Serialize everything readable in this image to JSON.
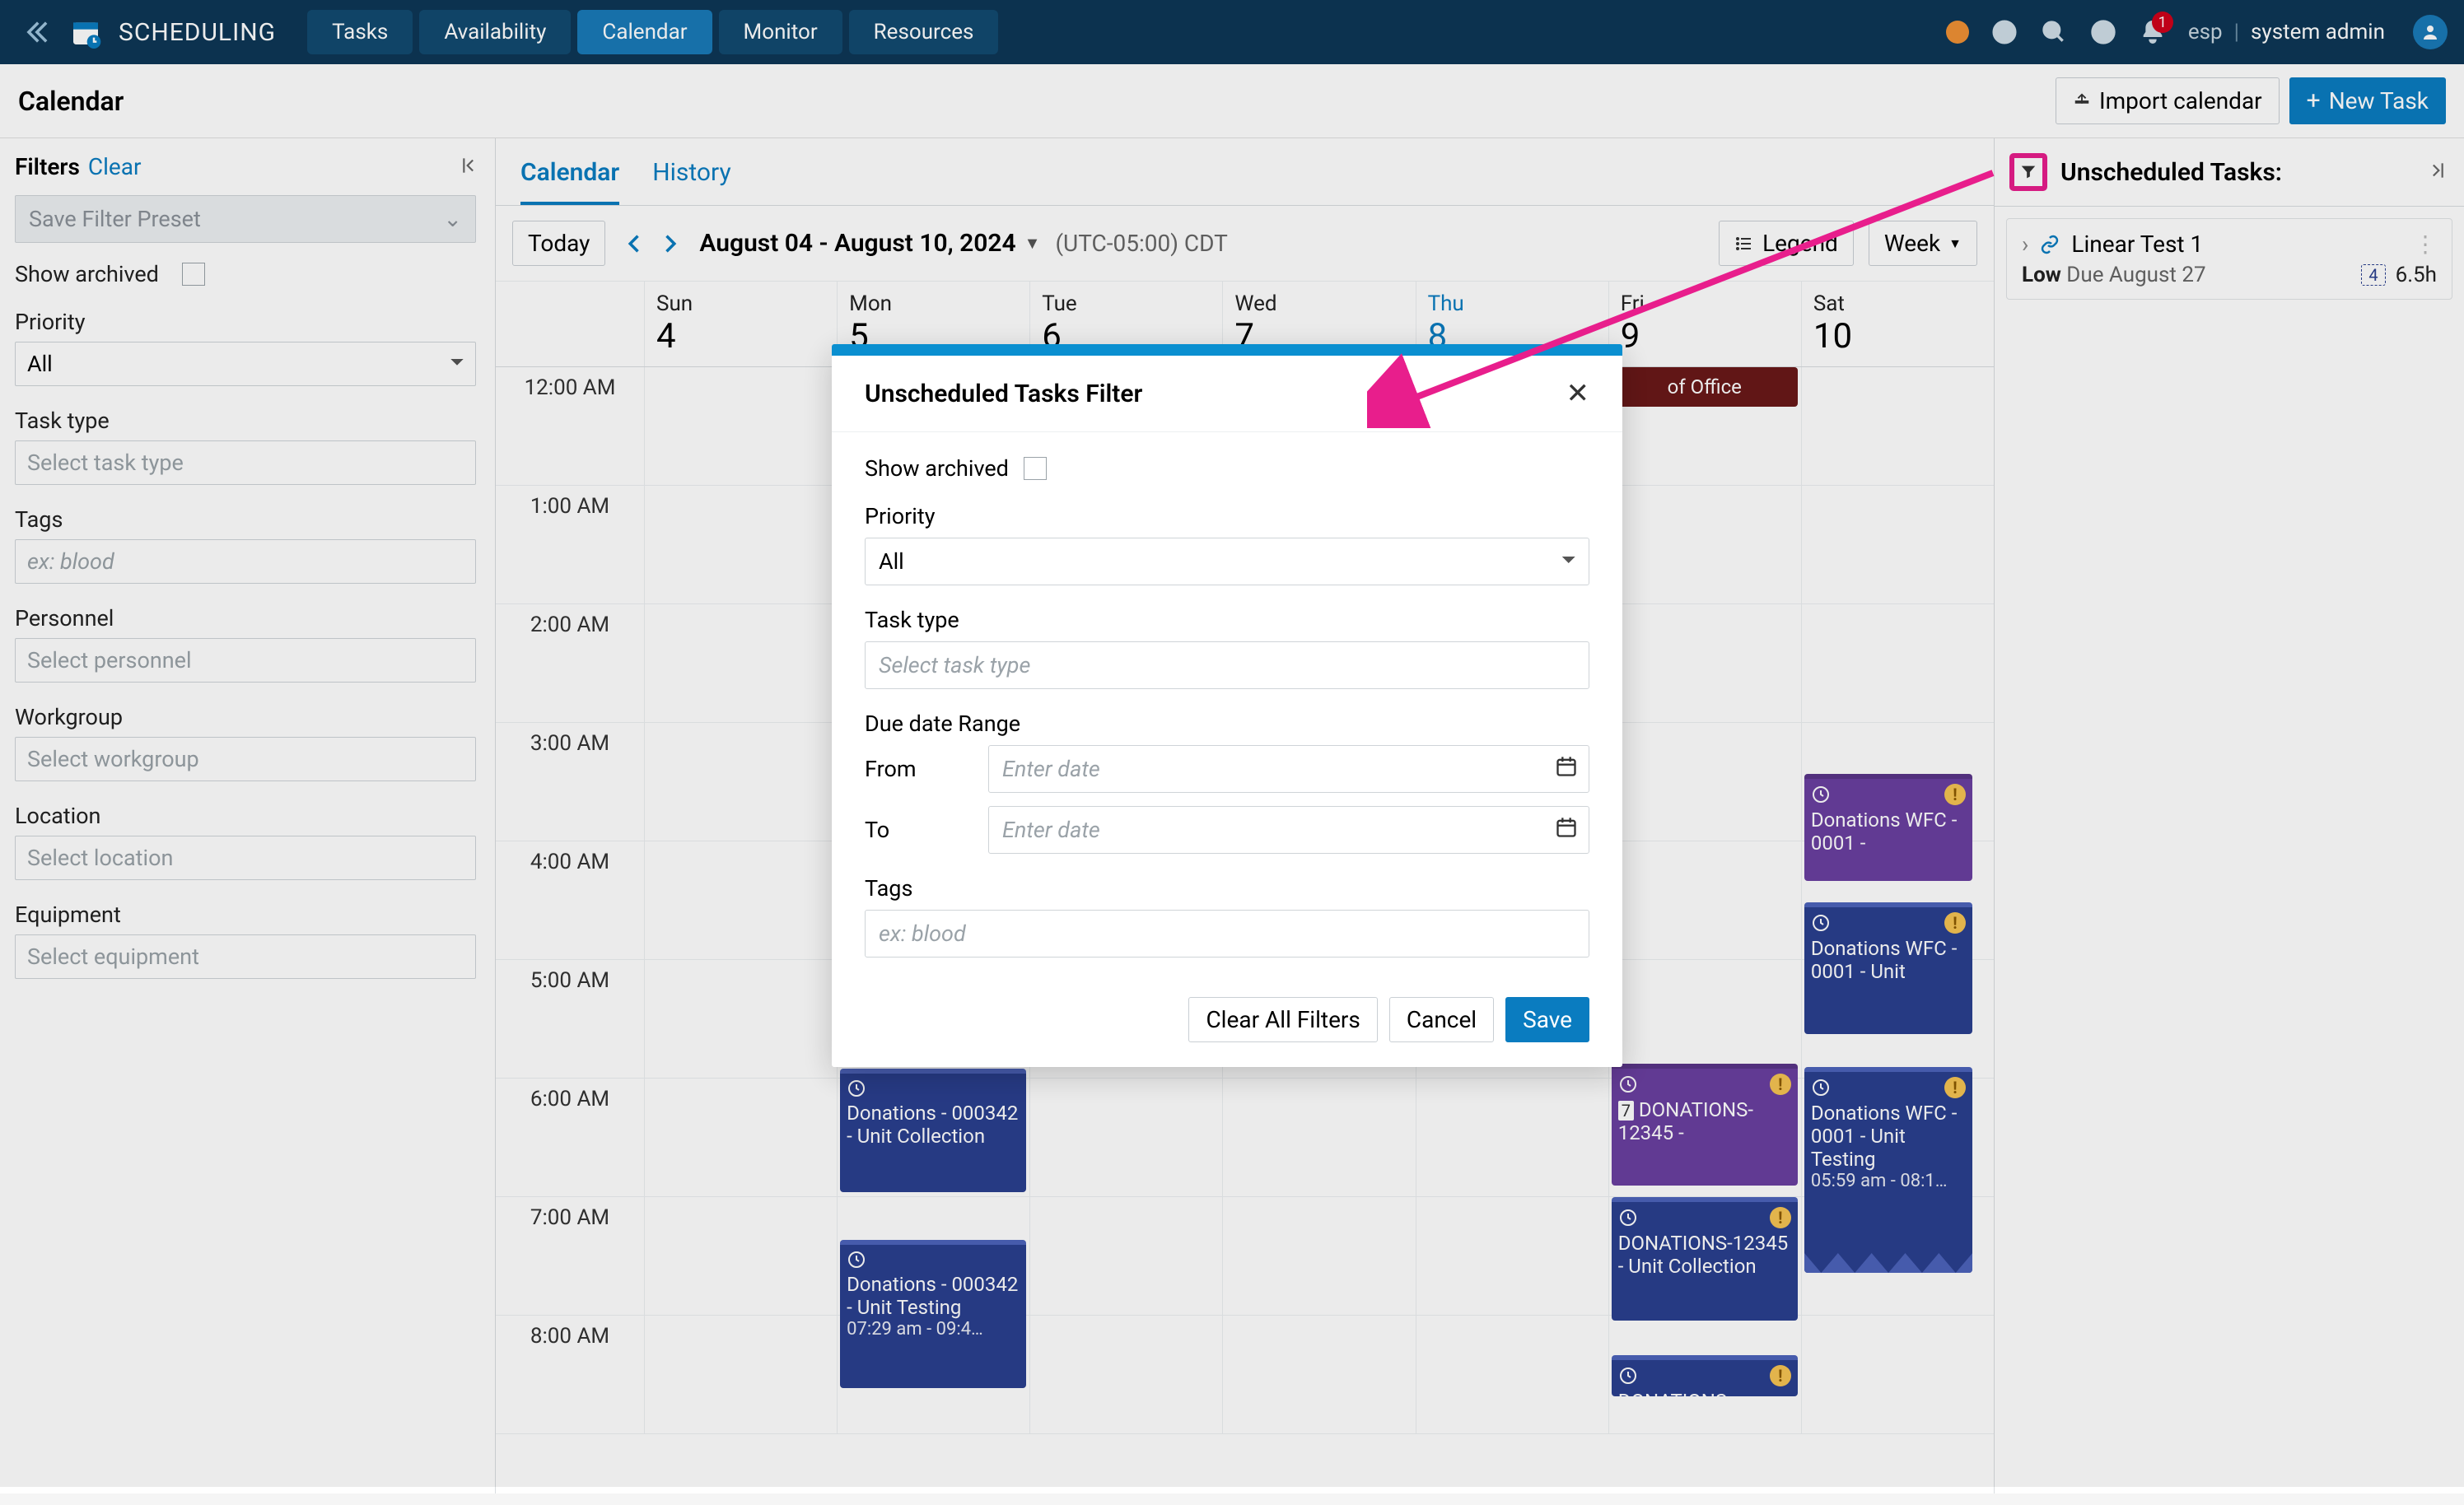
{
  "app": {
    "name": "SCHEDULING"
  },
  "nav": {
    "tabs": [
      "Tasks",
      "Availability",
      "Calendar",
      "Monitor",
      "Resources"
    ],
    "active": "Calendar"
  },
  "topbar": {
    "notifications_count": "1",
    "lang": "esp",
    "user": "system admin"
  },
  "page": {
    "title": "Calendar",
    "import_btn": "Import calendar",
    "new_task_btn": "New Task"
  },
  "sidebar": {
    "filters_label": "Filters",
    "clear_label": "Clear",
    "preset_placeholder": "Save Filter Preset",
    "show_archived_label": "Show archived",
    "priority_label": "Priority",
    "priority_value": "All",
    "task_type_label": "Task type",
    "task_type_placeholder": "Select task type",
    "tags_label": "Tags",
    "tags_placeholder": "ex: blood",
    "personnel_label": "Personnel",
    "personnel_placeholder": "Select personnel",
    "workgroup_label": "Workgroup",
    "workgroup_placeholder": "Select workgroup",
    "location_label": "Location",
    "location_placeholder": "Select location",
    "equipment_label": "Equipment",
    "equipment_placeholder": "Select equipment"
  },
  "calendar": {
    "tabs": {
      "calendar": "Calendar",
      "history": "History"
    },
    "today_btn": "Today",
    "range_label": "August 04 - August 10, 2024",
    "tz": "(UTC-05:00) CDT",
    "legend_btn": "Legend",
    "view_btn": "Week",
    "days": [
      {
        "dow": "Sun",
        "num": "4"
      },
      {
        "dow": "Mon",
        "num": "5"
      },
      {
        "dow": "Tue",
        "num": "6"
      },
      {
        "dow": "Wed",
        "num": "7"
      },
      {
        "dow": "Thu",
        "num": "8",
        "today": true
      },
      {
        "dow": "Fri",
        "num": "9"
      },
      {
        "dow": "Sat",
        "num": "10"
      }
    ],
    "hours": [
      "12:00 AM",
      "1:00 AM",
      "2:00 AM",
      "3:00 AM",
      "4:00 AM",
      "5:00 AM",
      "6:00 AM",
      "7:00 AM",
      "8:00 AM"
    ],
    "events": {
      "ooo_label": "of Office",
      "mon_1": "Donations - 000342 - Unit Collection",
      "mon_2": "Donations - 000342 - Unit Testing",
      "mon_2_time": "07:29 am - 09:4…",
      "fri_1": "DONATIONS-12345 -",
      "fri_2": "DONATIONS-12345 - Unit Collection",
      "fri_3": "DONATIONS",
      "sat_1": "Donations WFC - 0001 -",
      "sat_2": "Donations WFC - 0001 - Unit",
      "sat_3": "Donations WFC - 0001 - Unit Testing",
      "sat_3_time": "05:59 am - 08:1…"
    }
  },
  "right": {
    "title": "Unscheduled Tasks:",
    "task_1": {
      "name": "Linear Test 1",
      "priority": "Low",
      "due": "Due August 27",
      "count": "4",
      "hours": "6.5h"
    }
  },
  "modal": {
    "title": "Unscheduled Tasks Filter",
    "show_archived": "Show archived",
    "priority_label": "Priority",
    "priority_value": "All",
    "task_type_label": "Task type",
    "task_type_placeholder": "Select task type",
    "due_range_label": "Due date Range",
    "from_label": "From",
    "to_label": "To",
    "date_placeholder": "Enter date",
    "tags_label": "Tags",
    "tags_placeholder": "ex: blood",
    "clear_all_btn": "Clear All Filters",
    "cancel_btn": "Cancel",
    "save_btn": "Save"
  }
}
